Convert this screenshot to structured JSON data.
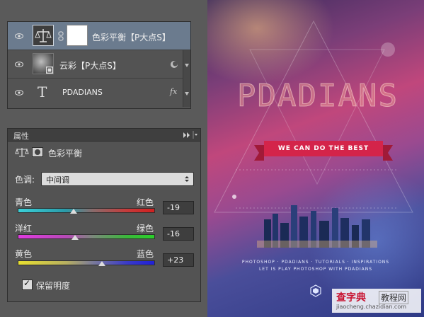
{
  "layers": [
    {
      "name": "色彩平衡【P大点S】",
      "selected": true,
      "type": "adjustment"
    },
    {
      "name": "云彩【P大点S】",
      "selected": false,
      "type": "smart-object"
    },
    {
      "name": "PDADIANS",
      "selected": false,
      "type": "text",
      "fx": "fx"
    }
  ],
  "properties": {
    "panel_title": "属性",
    "adjustment_name": "色彩平衡",
    "tone_label": "色调:",
    "tone_value": "中间调",
    "sliders": [
      {
        "left": "青色",
        "right": "红色",
        "value": "-19",
        "level": -19
      },
      {
        "left": "洋红",
        "right": "绿色",
        "value": "-16",
        "level": -16
      },
      {
        "left": "黄色",
        "right": "蓝色",
        "value": "+23",
        "level": 23
      }
    ],
    "preserve_luminosity": "保留明度",
    "menu_icon": "panel-menu-icon",
    "collapse_icon": "double-chevron-right-icon"
  },
  "poster": {
    "title": "PDADIANS",
    "ribbon": "WE CAN DO THE BEST",
    "tagline1": "PHOTOSHOP · PDADIANS · TUTORIALS · INSPIRATIONS",
    "tagline2": "LET IS PLAY PHOTOSHOP WITH PDADIANS"
  },
  "watermark": {
    "brand": "查字典",
    "label": "教程网",
    "url": "jiaocheng.chazidian.com"
  },
  "colors": {
    "selected_layer": "#6b7b8e",
    "ribbon": "#d4244a"
  }
}
